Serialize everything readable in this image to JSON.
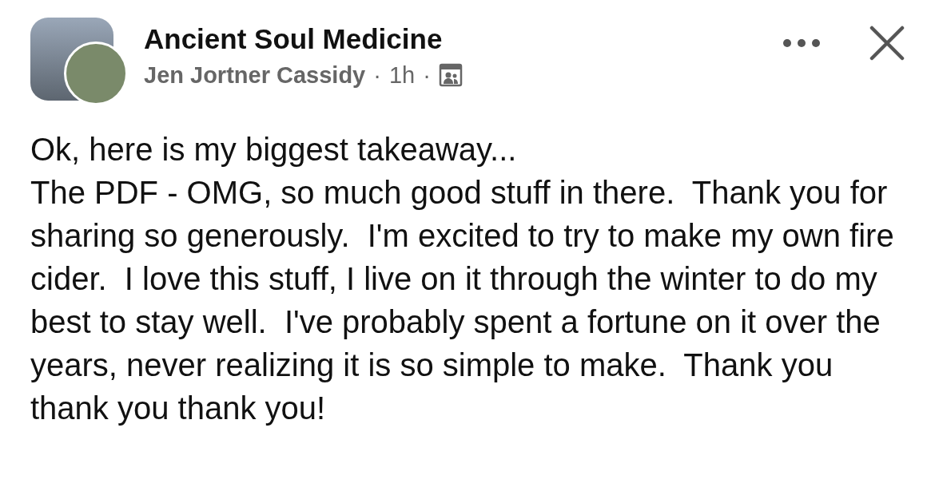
{
  "post": {
    "group_name": "Ancient Soul Medicine",
    "author": "Jen Jortner Cassidy",
    "separator_1": "·",
    "time": "1h",
    "separator_2": "·",
    "paragraphs": [
      "Ok, here is my biggest takeaway...",
      "The PDF - OMG, so much good stuff in there.  Thank you for sharing so generously.  I'm excited to try to make my own fire cider.  I love this stuff, I live on it through the winter to do my best to stay well.  I've probably spent a fortune on it over the years, never realizing it is so simple to make.  Thank you thank you thank you!"
    ]
  }
}
